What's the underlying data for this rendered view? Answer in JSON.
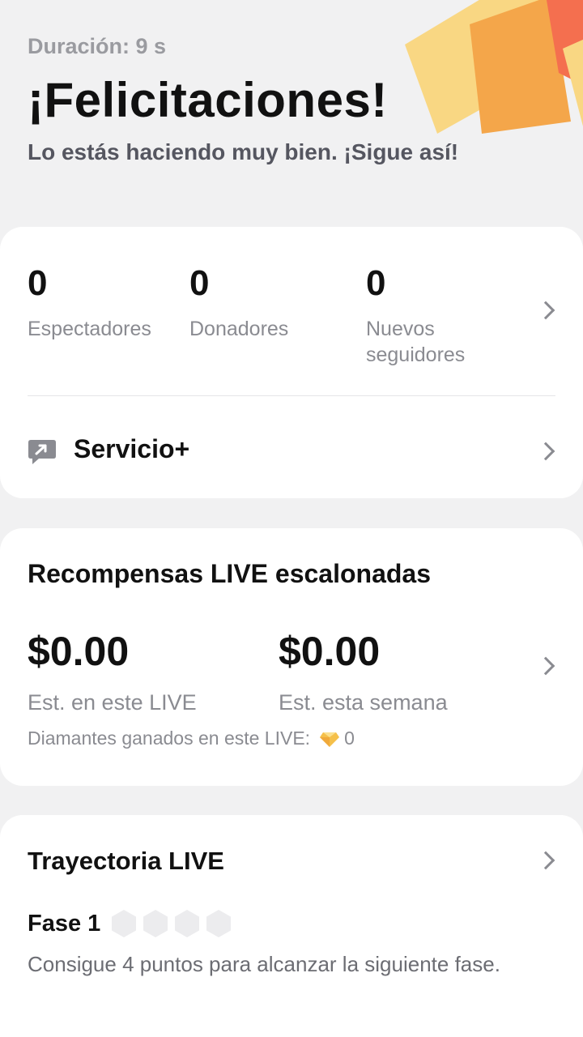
{
  "header": {
    "duration": "Duración: 9 s",
    "title": "¡Felicitaciones!",
    "subtitle": "Lo estás haciendo muy bien. ¡Sigue así!"
  },
  "stats": {
    "viewers": {
      "value": "0",
      "label": "Espectadores"
    },
    "donors": {
      "value": "0",
      "label": "Donadores"
    },
    "new_followers": {
      "value": "0",
      "label_line1": "Nuevos",
      "label_line2": "seguidores"
    }
  },
  "service": {
    "label": "Servicio+"
  },
  "rewards": {
    "title": "Recompensas LIVE escalonadas",
    "this_live": {
      "value": "$0.00",
      "label": "Est. en este LIVE"
    },
    "this_week": {
      "value": "$0.00",
      "label": "Est. esta semana"
    },
    "diamonds_label": "Diamantes ganados en este LIVE:",
    "diamonds_value": "0"
  },
  "journey": {
    "title": "Trayectoria LIVE",
    "phase_label": "Fase 1",
    "phase_points_filled": 0,
    "phase_points_total": 4,
    "description": "Consigue 4 puntos para alcanzar la siguiente fase."
  },
  "colors": {
    "background": "#f1f1f2",
    "card": "#ffffff",
    "confetti": [
      "#f8c25a",
      "#f4a64a",
      "#f46f4f",
      "#f9d783"
    ],
    "diamond": "#f5c04a"
  },
  "icons": [
    "confetti-decoration",
    "chevron-right-icon",
    "service-chat-icon",
    "diamond-icon",
    "hexagon-point-icon"
  ]
}
